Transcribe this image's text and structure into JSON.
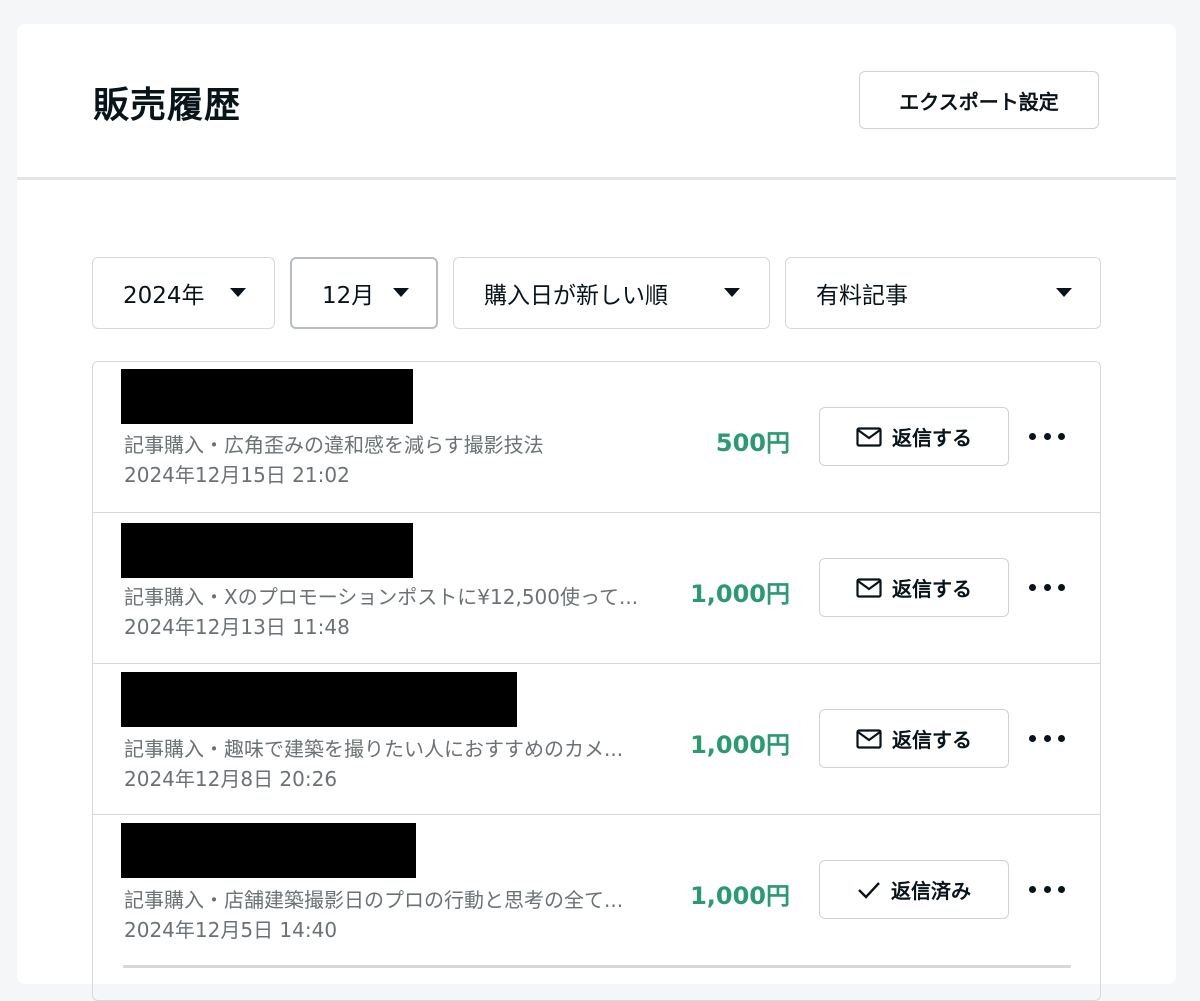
{
  "page": {
    "title": "販売履歴",
    "export_label": "エクスポート設定"
  },
  "filters": [
    {
      "label": "2024年",
      "icon": "caret-down-icon"
    },
    {
      "label": "12月",
      "icon": "caret-down-icon"
    },
    {
      "label": "購入日が新しい順",
      "icon": "caret-down-icon"
    },
    {
      "label": "有料記事",
      "icon": "caret-down-icon"
    }
  ],
  "sales": [
    {
      "title": "記事購入・広角歪みの違和感を減らす撮影技法",
      "date": "2024年12月15日 21:02",
      "price": "500円",
      "action_label": "返信する",
      "action_icon": "mail-icon"
    },
    {
      "title": "記事購入・Xのプロモーションポストに¥12,500使って...",
      "date": "2024年12月13日 11:48",
      "price": "1,000円",
      "action_label": "返信する",
      "action_icon": "mail-icon"
    },
    {
      "title": "記事購入・趣味で建築を撮りたい人におすすめのカメ...",
      "date": "2024年12月8日 20:26",
      "price": "1,000円",
      "action_label": "返信する",
      "action_icon": "mail-icon"
    },
    {
      "title": "記事購入・店舗建築撮影日のプロの行動と思考の全て...",
      "date": "2024年12月5日 14:40",
      "price": "1,000円",
      "action_label": "返信済み",
      "action_icon": "check-icon"
    }
  ],
  "colors": {
    "price": "#2b9a73",
    "text": "#08131a",
    "muted": "#6b7275",
    "border": "#d6d9db"
  }
}
